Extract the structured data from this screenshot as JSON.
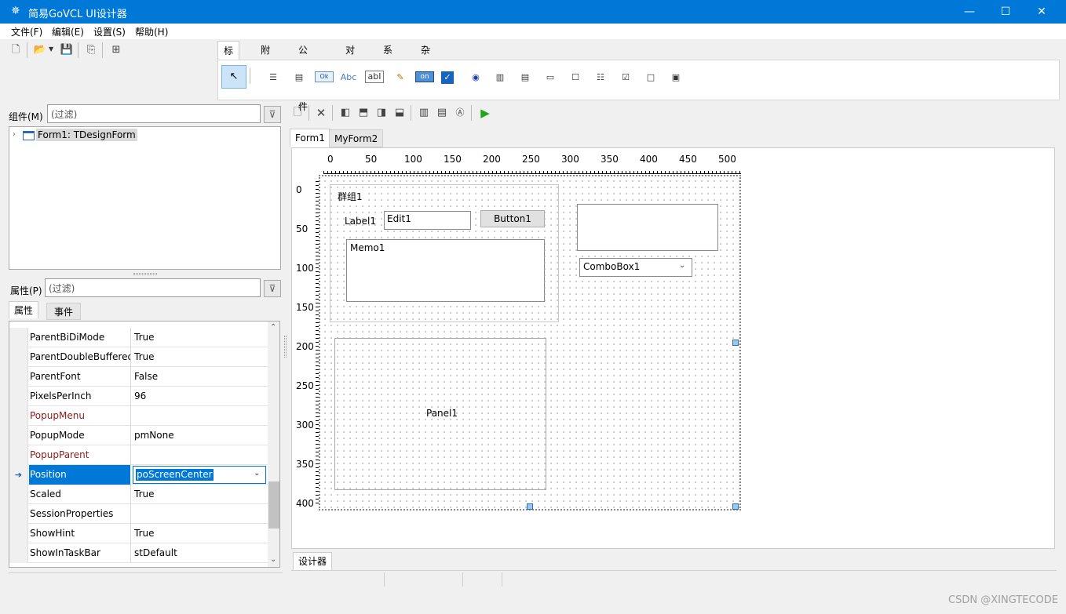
{
  "window": {
    "title": "简易GoVCL UI设计器"
  },
  "menu": [
    "文件(F)",
    "编辑(E)",
    "设置(S)",
    "帮助(H)"
  ],
  "palette": {
    "tabs": [
      "标准",
      "附加",
      "公共控件",
      "对话框",
      "系统",
      "杂项"
    ],
    "icons": [
      "Ok",
      "Abc",
      "abI",
      "on"
    ]
  },
  "components": {
    "label": "组件(M)",
    "filter_placeholder": "(过滤)",
    "tree_item": "Form1: TDesignForm"
  },
  "properties": {
    "label": "属性(P)",
    "filter_placeholder": "(过滤)",
    "tabs": [
      "属性",
      "事件"
    ],
    "rows": [
      {
        "name": "ParentBiDiMode",
        "value": "True"
      },
      {
        "name": "ParentDoubleBuffered",
        "value": "True"
      },
      {
        "name": "ParentFont",
        "value": "False"
      },
      {
        "name": "PixelsPerInch",
        "value": "96"
      },
      {
        "name": "PopupMenu",
        "value": ""
      },
      {
        "name": "PopupMode",
        "value": "pmNone"
      },
      {
        "name": "PopupParent",
        "value": ""
      },
      {
        "name": "Position",
        "value": "poScreenCenter"
      },
      {
        "name": "Scaled",
        "value": "True"
      },
      {
        "name": "SessionProperties",
        "value": ""
      },
      {
        "name": "ShowHint",
        "value": "True"
      },
      {
        "name": "ShowInTaskBar",
        "value": "stDefault"
      }
    ]
  },
  "designer": {
    "tabs": [
      "Form1",
      "MyForm2"
    ],
    "bottom_tab": "设计器",
    "ruler_x": [
      "0",
      "50",
      "100",
      "150",
      "200",
      "250",
      "300",
      "350",
      "400",
      "450",
      "500"
    ],
    "ruler_y": [
      "0",
      "50",
      "100",
      "150",
      "200",
      "250",
      "300",
      "350",
      "400"
    ],
    "controls": {
      "group": "群组1",
      "label": "Label1",
      "edit": "Edit1",
      "button": "Button1",
      "memo": "Memo1",
      "combobox": "ComboBox1",
      "panel": "Panel1"
    }
  },
  "colors": {
    "titlebar": "#0078d7",
    "selection": "#0078d7",
    "event_prop": "#8b1a1a"
  },
  "watermark": "CSDN @XINGTECODE"
}
